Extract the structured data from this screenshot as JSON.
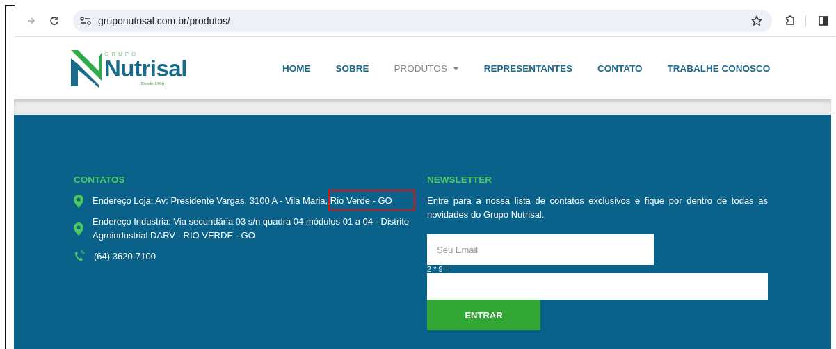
{
  "browser": {
    "url": "gruponutrisal.com.br/produtos/"
  },
  "logo": {
    "group": "GRUPO",
    "name": "Nutrisal",
    "since": "Desde 1966"
  },
  "nav": [
    {
      "label": "HOME",
      "selected": false,
      "dropdown": false
    },
    {
      "label": "SOBRE",
      "selected": false,
      "dropdown": false
    },
    {
      "label": "PRODUTOS",
      "selected": true,
      "dropdown": true
    },
    {
      "label": "REPRESENTANTES",
      "selected": false,
      "dropdown": false
    },
    {
      "label": "CONTATO",
      "selected": false,
      "dropdown": false
    },
    {
      "label": "TRABALHE CONOSCO",
      "selected": false,
      "dropdown": false
    }
  ],
  "contacts": {
    "title": "CONTATOS",
    "items": [
      {
        "kind": "location",
        "text": "Endereço Loja: Av: Presidente Vargas, 3100 A - Vila Maria, Rio Verde - GO"
      },
      {
        "kind": "location",
        "text": "Endereço Industria: Via secundária 03 s/n quadra 04 módulos 01 a 04 - Distrito Agroindustrial DARV - RIO VERDE - GO"
      },
      {
        "kind": "phone",
        "text": "(64) 3620-7100"
      }
    ]
  },
  "newsletter": {
    "title": "NEWSLETTER",
    "text": "Entre para a nossa lista de contatos exclusivos e fique por dentro de todas as novidades do Grupo Nutrisal.",
    "email": {
      "placeholder": "Seu Email"
    },
    "captcha_label": "2 * 9 =",
    "button": "ENTRAR"
  }
}
